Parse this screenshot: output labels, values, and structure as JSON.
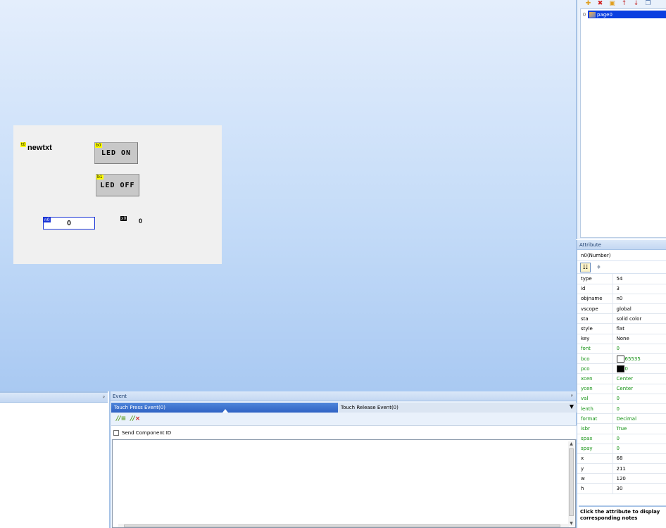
{
  "canvas": {
    "components": {
      "t0": {
        "tag": "t0",
        "text": "newtxt"
      },
      "b0": {
        "tag": "b0",
        "text": "LED ON"
      },
      "b1": {
        "tag": "b1",
        "text": "LED OFF"
      },
      "n0": {
        "tag": "n0",
        "value": "0"
      },
      "x0": {
        "tag": "x0",
        "value": "0"
      }
    }
  },
  "page_list": {
    "pages": [
      {
        "index": "0",
        "name": "page0"
      }
    ]
  },
  "attribute_panel": {
    "header": "Attribute",
    "object_title": "n0(Number)",
    "rows": [
      {
        "key": "type",
        "value": "54"
      },
      {
        "key": "id",
        "value": "3"
      },
      {
        "key": "objname",
        "value": "n0"
      },
      {
        "key": "vscope",
        "value": "global"
      },
      {
        "key": "sta",
        "value": "solid color"
      },
      {
        "key": "style",
        "value": "flat"
      },
      {
        "key": "key",
        "value": "None"
      },
      {
        "key": "font",
        "value": "0"
      },
      {
        "key": "bco",
        "value": "65535"
      },
      {
        "key": "pco",
        "value": "0"
      },
      {
        "key": "xcen",
        "value": "Center"
      },
      {
        "key": "ycen",
        "value": "Center"
      },
      {
        "key": "val",
        "value": "0"
      },
      {
        "key": "lenth",
        "value": "0"
      },
      {
        "key": "format",
        "value": "Decimal"
      },
      {
        "key": "isbr",
        "value": "True"
      },
      {
        "key": "spax",
        "value": "0"
      },
      {
        "key": "spay",
        "value": "0"
      },
      {
        "key": "x",
        "value": "68"
      },
      {
        "key": "y",
        "value": "211"
      },
      {
        "key": "w",
        "value": "120"
      },
      {
        "key": "h",
        "value": "30"
      }
    ],
    "note": "Click the attribute to display corresponding notes"
  },
  "event_panel": {
    "header": "Event",
    "tabs": [
      {
        "label": "Touch Press Event(0)"
      },
      {
        "label": "Touch Release Event(0)"
      }
    ],
    "send_component_id_label": "Send Component ID"
  },
  "colors": {
    "selection": "#0a3fe0",
    "attribute_green": "#0f8f0f",
    "tag_yellow": "#ffff00"
  }
}
